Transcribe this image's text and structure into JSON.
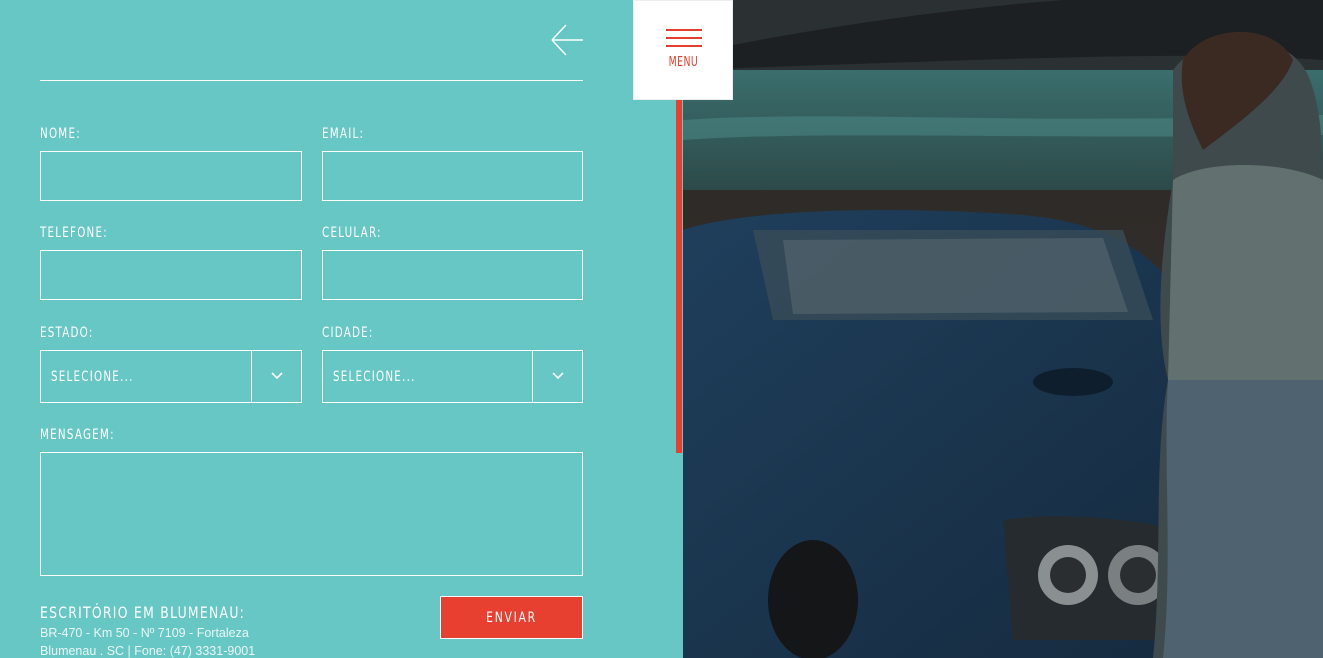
{
  "form": {
    "name_label": "NOME:",
    "email_label": "EMAIL:",
    "phone_label": "TELEFONE:",
    "mobile_label": "CELULAR:",
    "state_label": "ESTADO:",
    "city_label": "CIDADE:",
    "message_label": "MENSAGEM:",
    "state_value": "SELECIONE...",
    "city_value": "SELECIONE...",
    "name_value": "",
    "email_value": "",
    "phone_value": "",
    "mobile_value": "",
    "message_value": ""
  },
  "office": {
    "title": "ESCRITÓRIO EM BLUMENAU:",
    "address_line1": "BR-470 - Km 50 - Nº 7109 - Fortaleza",
    "address_line2": "Blumenau . SC | Fone: (47) 3331-9001"
  },
  "actions": {
    "send_label": "ENVIAR",
    "menu_label": "MENU"
  },
  "icons": {
    "back": "arrow-left-icon",
    "menu": "hamburger-icon",
    "select": "chevron-down-icon"
  },
  "colors": {
    "panel": "#66c7c4",
    "accent": "#e84030",
    "text": "#ffffff"
  }
}
